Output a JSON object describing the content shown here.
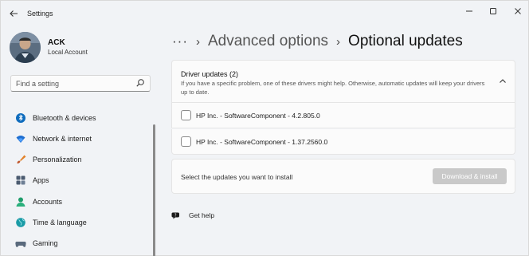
{
  "window": {
    "title": "Settings",
    "controls": {
      "minimize_icon": "minimize-icon",
      "maximize_icon": "maximize-icon",
      "close_icon": "close-icon"
    }
  },
  "profile": {
    "name": "ACK",
    "account_type": "Local Account"
  },
  "search": {
    "placeholder": "Find a setting"
  },
  "sidebar": {
    "items": [
      {
        "label": "Bluetooth & devices",
        "icon": "bluetooth-icon"
      },
      {
        "label": "Network & internet",
        "icon": "wifi-icon"
      },
      {
        "label": "Personalization",
        "icon": "brush-icon"
      },
      {
        "label": "Apps",
        "icon": "apps-icon"
      },
      {
        "label": "Accounts",
        "icon": "accounts-icon"
      },
      {
        "label": "Time & language",
        "icon": "globe-icon"
      },
      {
        "label": "Gaming",
        "icon": "gaming-icon"
      }
    ]
  },
  "breadcrumb": {
    "overflow": "···",
    "parent": "Advanced options",
    "current": "Optional updates"
  },
  "drivers": {
    "title": "Driver updates (2)",
    "description": "If you have a specific problem, one of these drivers might help. Otherwise, automatic updates will keep your drivers up to date.",
    "items": [
      {
        "label": "HP Inc. - SoftwareComponent - 4.2.805.0",
        "checked": false
      },
      {
        "label": "HP Inc. - SoftwareComponent - 1.37.2560.0",
        "checked": false
      }
    ]
  },
  "install": {
    "prompt": "Select the updates you want to install",
    "button_label": "Download & install"
  },
  "help": {
    "label": "Get help"
  },
  "colors": {
    "accent": "#0067c0",
    "disabled_button": "#c9c9c9",
    "window_bg": "#f1f3f6",
    "card_bg": "#fbfbfb"
  }
}
